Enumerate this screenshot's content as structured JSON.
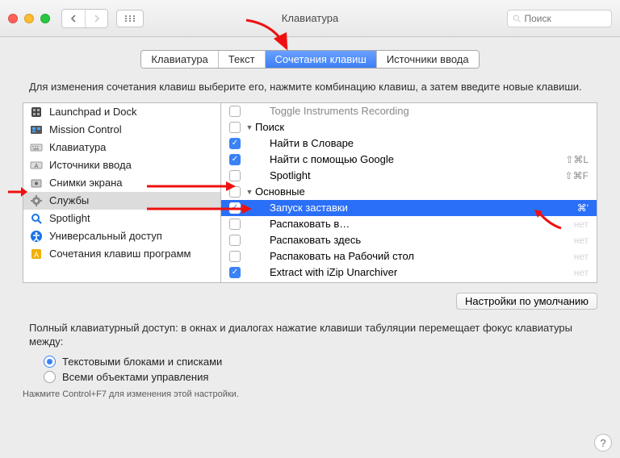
{
  "window": {
    "title": "Клавиатура",
    "search_placeholder": "Поиск"
  },
  "tabs": [
    {
      "label": "Клавиатура"
    },
    {
      "label": "Текст"
    },
    {
      "label": "Сочетания клавиш",
      "active": true
    },
    {
      "label": "Источники ввода"
    }
  ],
  "instruction": "Для изменения сочетания клавиш выберите его, нажмите комбинацию клавиш, а затем введите новые клавиши.",
  "categories": [
    {
      "label": "Launchpad и Dock",
      "icon": "launchpad"
    },
    {
      "label": "Mission Control",
      "icon": "mission"
    },
    {
      "label": "Клавиатура",
      "icon": "keyboard"
    },
    {
      "label": "Источники ввода",
      "icon": "input"
    },
    {
      "label": "Снимки экрана",
      "icon": "screenshot"
    },
    {
      "label": "Службы",
      "icon": "services",
      "selected": true
    },
    {
      "label": "Spotlight",
      "icon": "spotlight"
    },
    {
      "label": "Универсальный доступ",
      "icon": "accessibility"
    },
    {
      "label": "Сочетания клавиш программ",
      "icon": "apps"
    }
  ],
  "services": [
    {
      "label": "Toggle Instruments Recording",
      "checked": false,
      "cut": true,
      "header": false,
      "indent": true
    },
    {
      "label": "Поиск",
      "checked": false,
      "header": true,
      "expanded": true
    },
    {
      "label": "Найти в Словаре",
      "checked": true,
      "indent": true
    },
    {
      "label": "Найти с помощью Google",
      "checked": true,
      "indent": true,
      "shortcut": "⇧⌘L"
    },
    {
      "label": "Spotlight",
      "checked": false,
      "indent": true,
      "shortcut": "⇧⌘F"
    },
    {
      "label": "Основные",
      "checked": false,
      "header": true,
      "expanded": true
    },
    {
      "label": "Запуск заставки",
      "checked": true,
      "indent": true,
      "selected": true,
      "shortcut": "⌘'"
    },
    {
      "label": "Распаковать в…",
      "checked": false,
      "indent": true,
      "shortcut_dim": "нет"
    },
    {
      "label": "Распаковать здесь",
      "checked": false,
      "indent": true,
      "shortcut_dim": "нет"
    },
    {
      "label": "Распаковать на Рабочий стол",
      "checked": false,
      "indent": true,
      "shortcut_dim": "нет"
    },
    {
      "label": "Extract with iZip Unarchiver",
      "checked": true,
      "indent": true,
      "shortcut_dim": "нет"
    }
  ],
  "defaults_button": "Настройки по умолчанию",
  "fka": {
    "text": "Полный клавиатурный доступ: в окнах и диалогах нажатие клавиши табуляции перемещает фокус клавиатуры между:",
    "options": [
      {
        "label": "Текстовыми блоками и списками",
        "on": true
      },
      {
        "label": "Всеми объектами управления",
        "on": false
      }
    ],
    "hint": "Нажмите Control+F7 для изменения этой настройки."
  }
}
